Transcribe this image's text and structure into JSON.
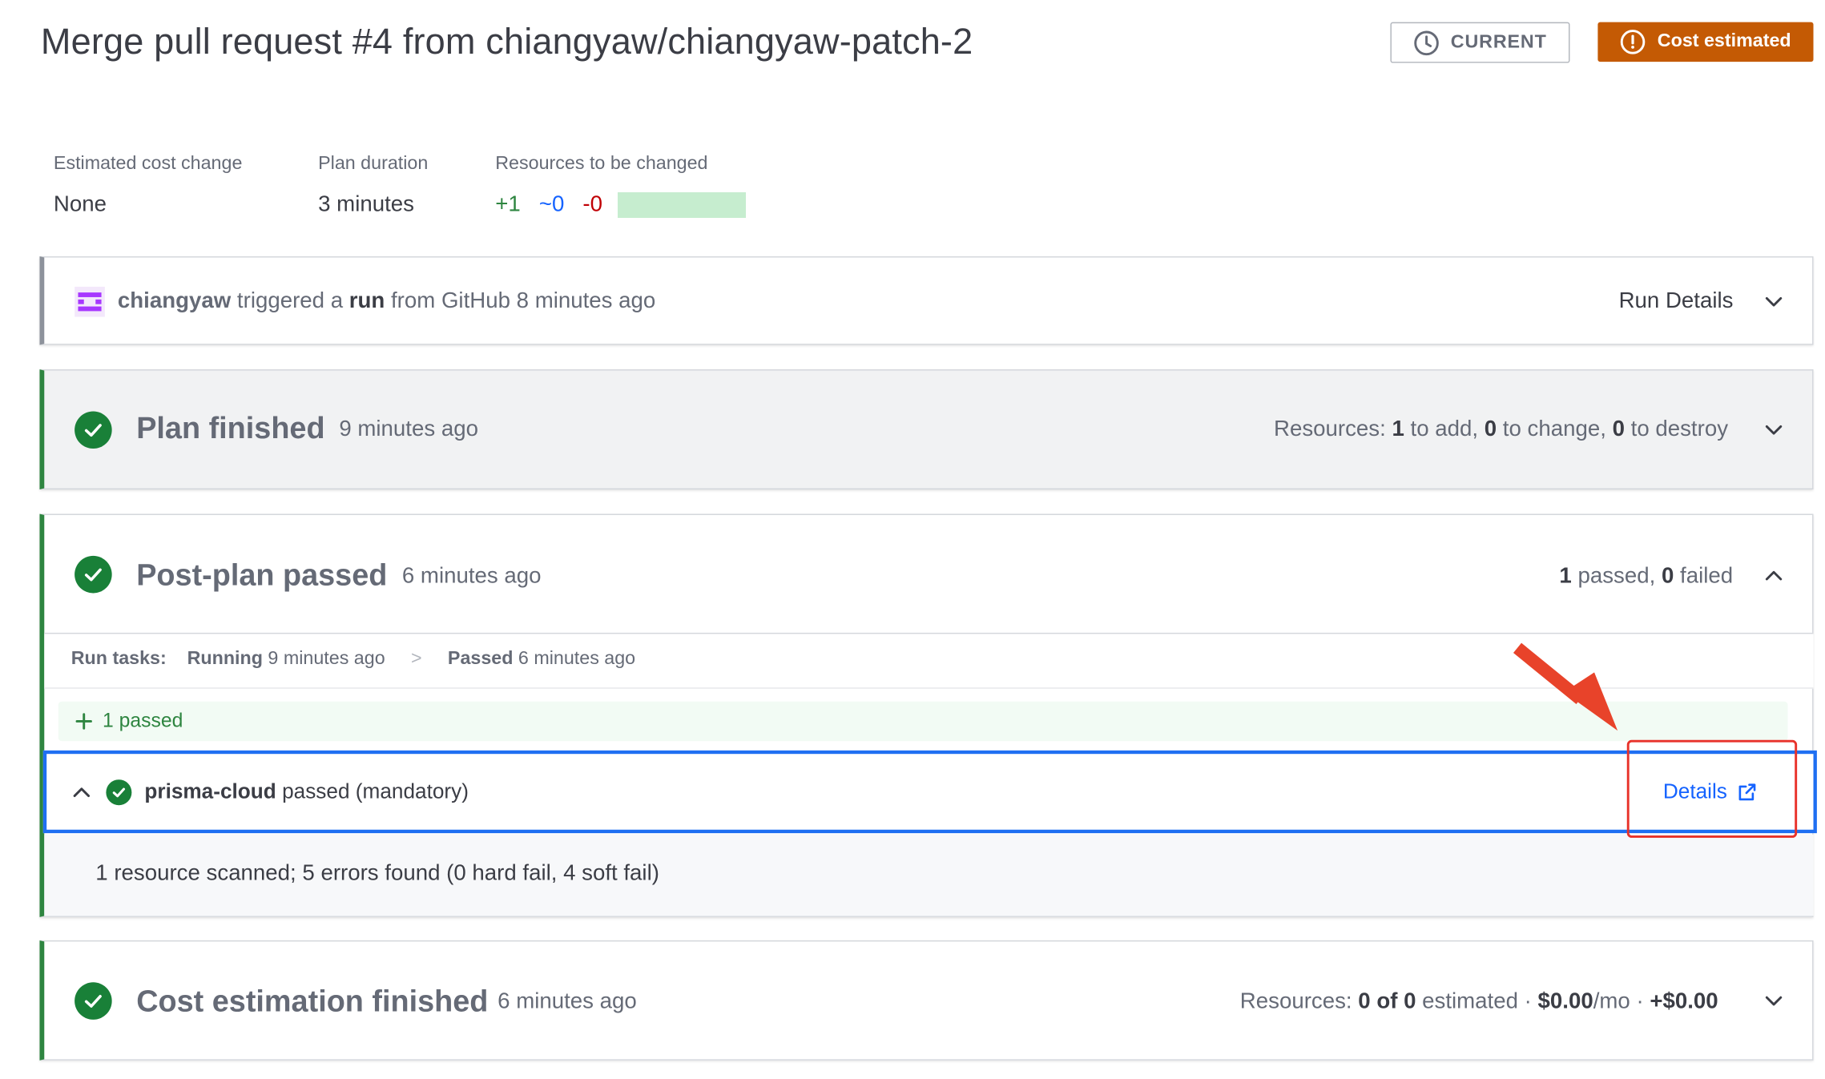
{
  "header": {
    "title": "Merge pull request #4 from chiangyaw/chiangyaw-patch-2",
    "current_label": "CURRENT",
    "cost_label": "Cost estimated",
    "cost_color": "#c45a04"
  },
  "stats": {
    "cost_change_label": "Estimated cost change",
    "cost_change_value": "None",
    "plan_duration_label": "Plan duration",
    "plan_duration_value": "3 minutes",
    "resources_label": "Resources to be changed",
    "add": "+1",
    "change": "~0",
    "destroy": "-0"
  },
  "run_panel": {
    "user": "chiangyaw",
    "text1": " triggered a ",
    "run_word": "run",
    "text2": " from GitHub 8 minutes ago",
    "details_label": "Run Details"
  },
  "plan_panel": {
    "title": "Plan finished",
    "time": "9 minutes ago",
    "res_prefix": "Resources: ",
    "add_count": "1",
    "add_text": " to add, ",
    "change_count": "0",
    "change_text": " to change, ",
    "destroy_count": "0",
    "destroy_text": " to destroy"
  },
  "postplan_panel": {
    "title": "Post-plan passed",
    "time": "6 minutes ago",
    "passed_count": "1",
    "passed_text": " passed, ",
    "failed_count": "0",
    "failed_text": " failed",
    "run_tasks_label": "Run tasks:",
    "running_label": "Running",
    "running_time": " 9 minutes ago",
    "sep": ">",
    "passed_label": "Passed",
    "passed_time": " 6 minutes ago",
    "banner_text": "1 passed",
    "task_name": "prisma-cloud",
    "task_status": " passed (mandatory)",
    "details_label": "Details",
    "scan_summary": "1 resource scanned; 5 errors found (0 hard fail, 4 soft fail)"
  },
  "cost_panel": {
    "title": "Cost estimation finished",
    "time": "6 minutes ago",
    "res_prefix": "Resources: ",
    "count": "0 of 0",
    "estimated": " estimated · ",
    "monthly": "$0.00",
    "mo": "/mo · ",
    "delta": "+$0.00"
  }
}
